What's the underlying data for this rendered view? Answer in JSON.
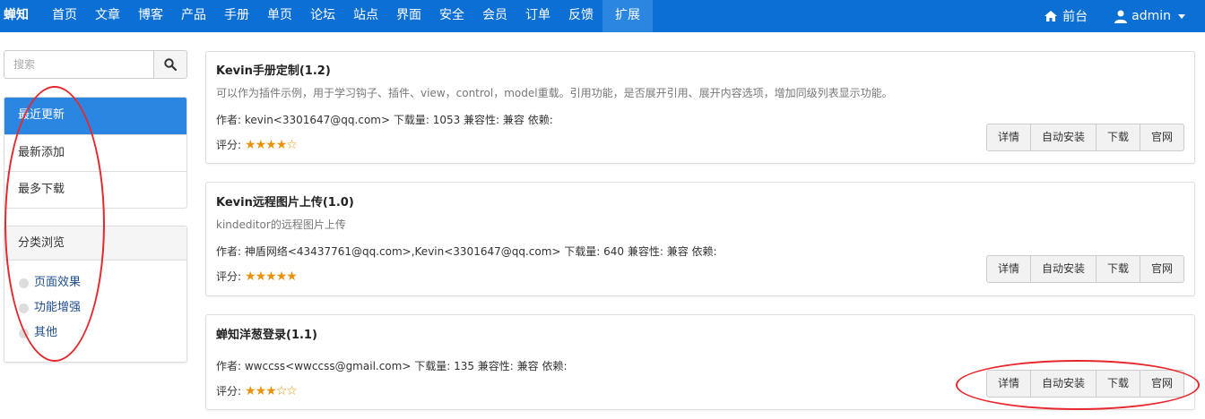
{
  "navbar": {
    "brand": "蝉知",
    "items": [
      "首页",
      "文章",
      "博客",
      "产品",
      "手册",
      "单页",
      "论坛",
      "站点",
      "界面",
      "安全",
      "会员",
      "订单",
      "反馈",
      "扩展"
    ],
    "active_item": "扩展",
    "frontend_label": "前台",
    "user_label": "admin"
  },
  "sidebar": {
    "search_placeholder": "搜索",
    "sort_items": [
      "最近更新",
      "最新添加",
      "最多下载"
    ],
    "active_sort": "最近更新",
    "category_title": "分类浏览",
    "categories": [
      "页面效果",
      "功能增强",
      "其他"
    ]
  },
  "buttons": {
    "detail": "详情",
    "auto_install": "自动安装",
    "download": "下载",
    "official": "官网"
  },
  "rating_label": "评分:",
  "extensions": [
    {
      "title": "Kevin手册定制(1.2)",
      "description": "可以作为插件示例，用于学习钩子、插件、view，control，model重载。引用功能，是否展开引用、展开内容选项，增加同级列表显示功能。",
      "meta": "作者: kevin<3301647@qq.com> 下载量: 1053 兼容性: 兼容 依赖:",
      "rating": 4
    },
    {
      "title": "Kevin远程图片上传(1.0)",
      "description": "kindeditor的远程图片上传",
      "meta": "作者: 神盾网络<43437761@qq.com>,Kevin<3301647@qq.com> 下载量: 640 兼容性: 兼容 依赖:",
      "rating": 5
    },
    {
      "title": "蝉知洋葱登录(1.1)",
      "description": "",
      "meta": "作者: wwccss<wwccss@gmail.com> 下载量: 135 兼容性: 兼容 依赖:",
      "rating": 3
    }
  ],
  "colors": {
    "navbar": "#0c6fd3",
    "active": "#2b86e2",
    "star": "#e7920a",
    "annotation": "#e8272d"
  }
}
